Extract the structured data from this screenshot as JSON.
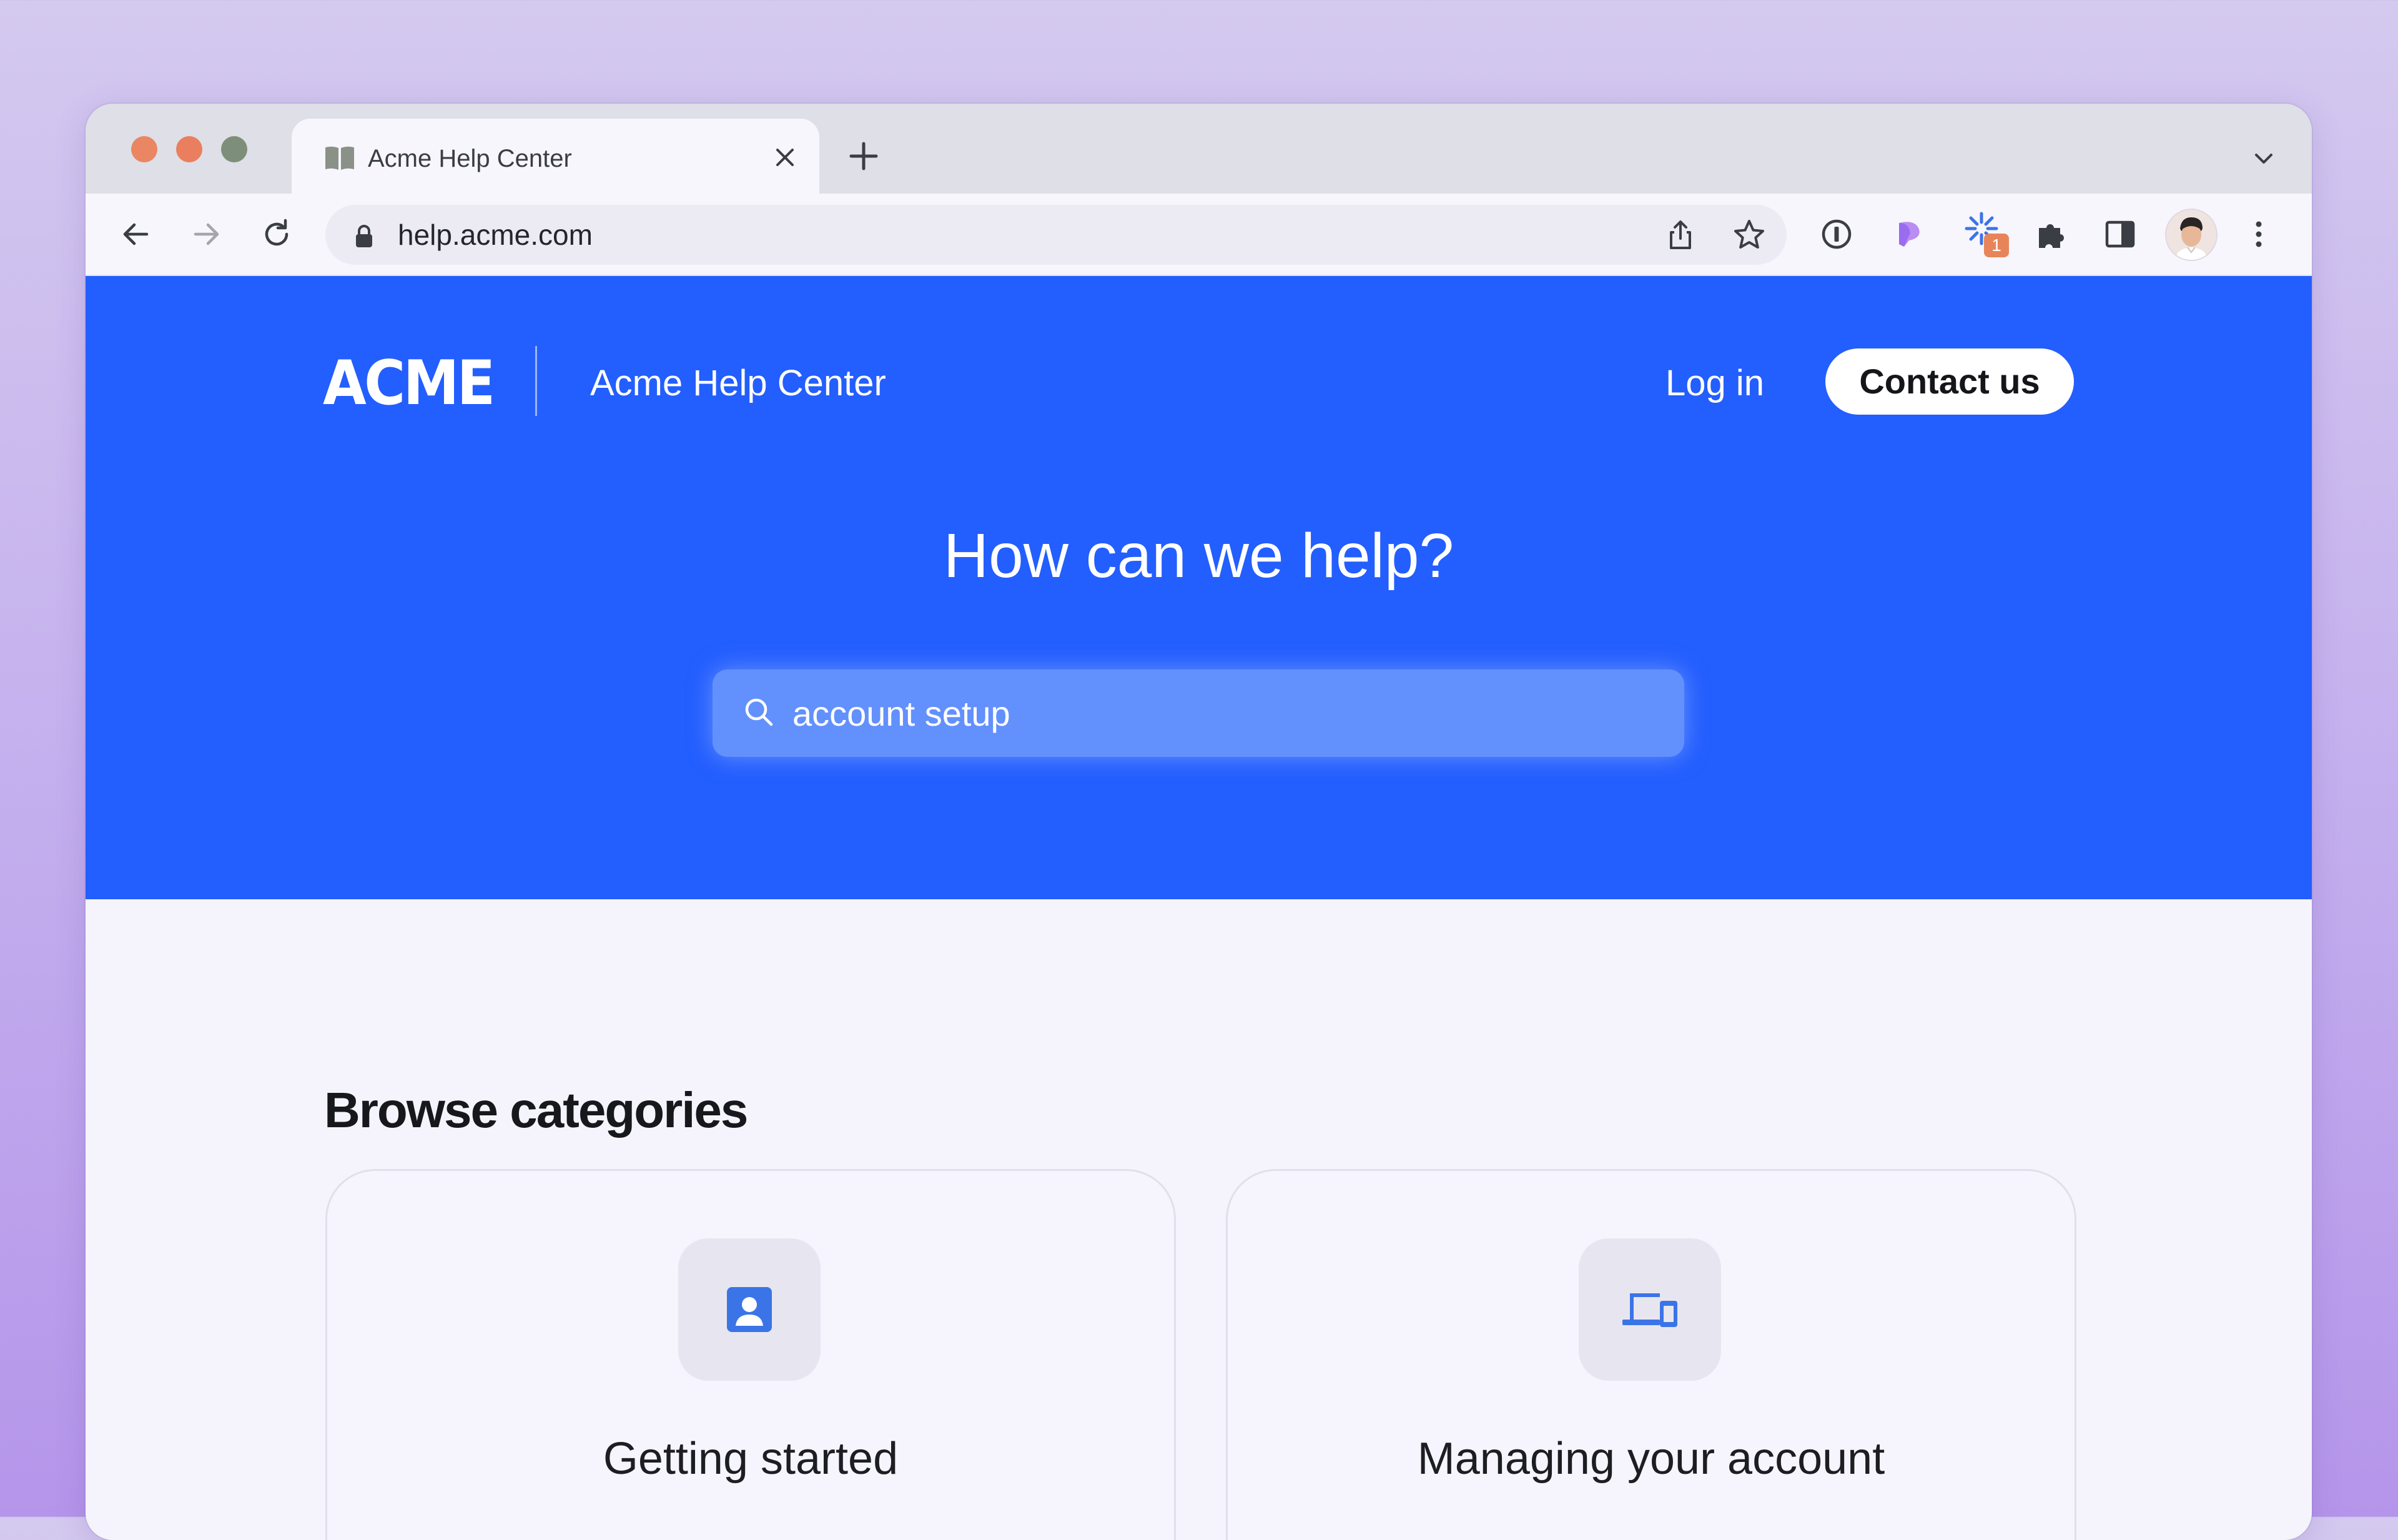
{
  "browser": {
    "tab": {
      "title": "Acme Help Center",
      "favicon": "book-icon"
    },
    "url": "help.acme.com",
    "extensions": [
      "password-manager-icon",
      "wand-icon",
      "sparkle-icon",
      "puzzle-icon"
    ],
    "extension_badge": "1"
  },
  "header": {
    "logo": "ACME",
    "site_title": "Acme Help Center",
    "login_label": "Log in",
    "contact_label": "Contact us"
  },
  "hero": {
    "title": "How can we help?",
    "search_value": "account setup"
  },
  "browse": {
    "title": "Browse categories",
    "categories": [
      {
        "label": "Getting started",
        "icon": "contact-card-icon"
      },
      {
        "label": "Managing your account",
        "icon": "devices-icon"
      }
    ]
  },
  "colors": {
    "brand_blue": "#235EFE",
    "search_fill": "#6290FD",
    "badge_orange": "#E8845A",
    "icon_blue": "#3B74E6"
  }
}
